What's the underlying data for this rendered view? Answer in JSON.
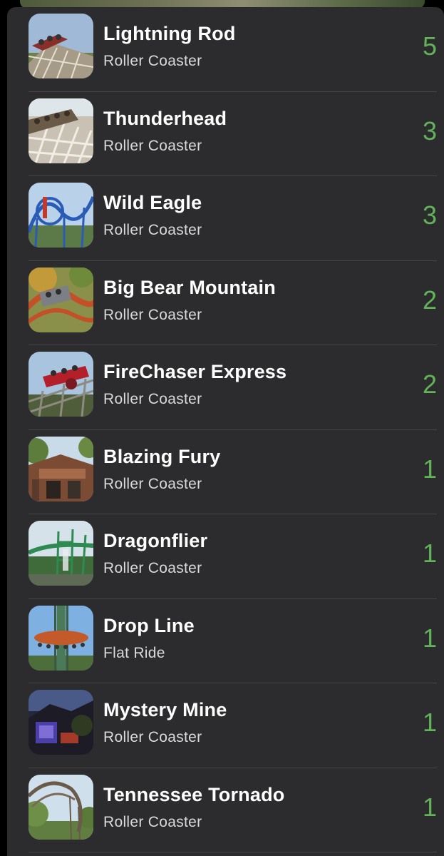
{
  "rides": [
    {
      "name": "Lightning Rod",
      "type": "Roller Coaster",
      "count": "5",
      "thumb": "wooden-coaster-train-icon"
    },
    {
      "name": "Thunderhead",
      "type": "Roller Coaster",
      "count": "3",
      "thumb": "wooden-coaster-riders-icon"
    },
    {
      "name": "Wild Eagle",
      "type": "Roller Coaster",
      "count": "3",
      "thumb": "blue-steel-wing-coaster-icon"
    },
    {
      "name": "Big Bear Mountain",
      "type": "Roller Coaster",
      "count": "2",
      "thumb": "orange-track-coaster-icon"
    },
    {
      "name": "FireChaser Express",
      "type": "Roller Coaster",
      "count": "2",
      "thumb": "red-train-coaster-icon"
    },
    {
      "name": "Blazing Fury",
      "type": "Roller Coaster",
      "count": "1",
      "thumb": "building-entrance-icon"
    },
    {
      "name": "Dragonflier",
      "type": "Roller Coaster",
      "count": "1",
      "thumb": "green-steel-coaster-icon"
    },
    {
      "name": "Drop Line",
      "type": "Flat Ride",
      "count": "1",
      "thumb": "drop-tower-icon"
    },
    {
      "name": "Mystery Mine",
      "type": "Roller Coaster",
      "count": "1",
      "thumb": "dark-ride-building-icon"
    },
    {
      "name": "Tennessee Tornado",
      "type": "Roller Coaster",
      "count": "1",
      "thumb": "loop-coaster-icon"
    }
  ],
  "colors": {
    "background": "#2c2c2e",
    "count": "#62b35a",
    "divider": "#454548"
  }
}
